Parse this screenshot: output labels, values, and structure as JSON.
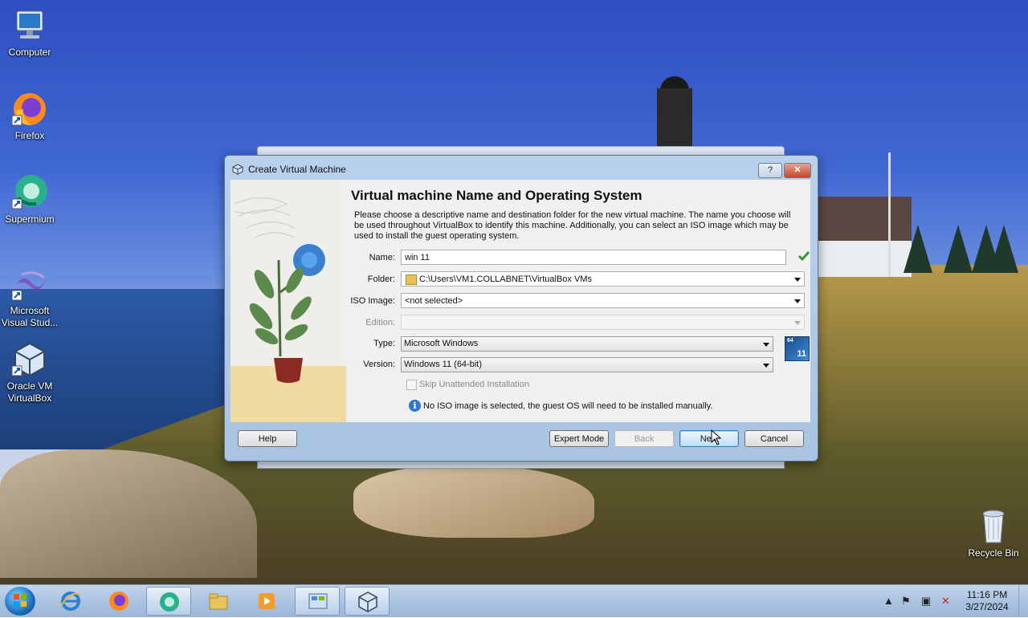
{
  "desktop": {
    "icons": [
      {
        "label": "Computer",
        "icon": "computer-icon"
      },
      {
        "label": "Firefox",
        "icon": "firefox-icon"
      },
      {
        "label": "Supermium",
        "icon": "supermium-icon"
      },
      {
        "label": "Microsoft Visual Stud...",
        "icon": "visual-studio-icon"
      },
      {
        "label": "Oracle VM VirtualBox",
        "icon": "virtualbox-icon"
      },
      {
        "label": "Recycle Bin",
        "icon": "recycle-bin-icon"
      }
    ]
  },
  "dialog": {
    "title": "Create Virtual Machine",
    "help_glyph": "?",
    "close_glyph": "✕",
    "heading": "Virtual machine Name and Operating System",
    "description": "Please choose a descriptive name and destination folder for the new virtual machine. The name you choose will be used throughout VirtualBox to identify this machine. Additionally, you can select an ISO image which may be used to install the guest operating system.",
    "fields": {
      "name_label": "Name:",
      "name_value": "win 11",
      "folder_label": "Folder:",
      "folder_value": "C:\\Users\\VM1.COLLABNET\\VirtualBox VMs",
      "iso_label": "ISO Image:",
      "iso_value": "<not selected>",
      "edition_label": "Edition:",
      "edition_value": "",
      "type_label": "Type:",
      "type_value": "Microsoft Windows",
      "version_label": "Version:",
      "version_value": "Windows 11 (64-bit)"
    },
    "os_badge": {
      "top": "64",
      "bottom": "11"
    },
    "skip_unattended_label": "Skip Unattended Installation",
    "info_glyph": "i",
    "info_message": "No ISO image is selected, the guest OS will need to be installed manually.",
    "buttons": {
      "help": "Help",
      "expert": "Expert Mode",
      "back": "Back",
      "next": "Next",
      "cancel": "Cancel"
    }
  },
  "taskbar": {
    "items": [
      "start-button",
      "internet-explorer",
      "firefox",
      "supermium",
      "file-explorer",
      "media-player",
      "control-panel",
      "virtualbox"
    ],
    "clock_time": "11:16 PM",
    "clock_date": "3/27/2024",
    "tray_glyphs": {
      "arrow": "▲",
      "flag": "⚑",
      "network": "▣",
      "volume": "✕"
    }
  }
}
